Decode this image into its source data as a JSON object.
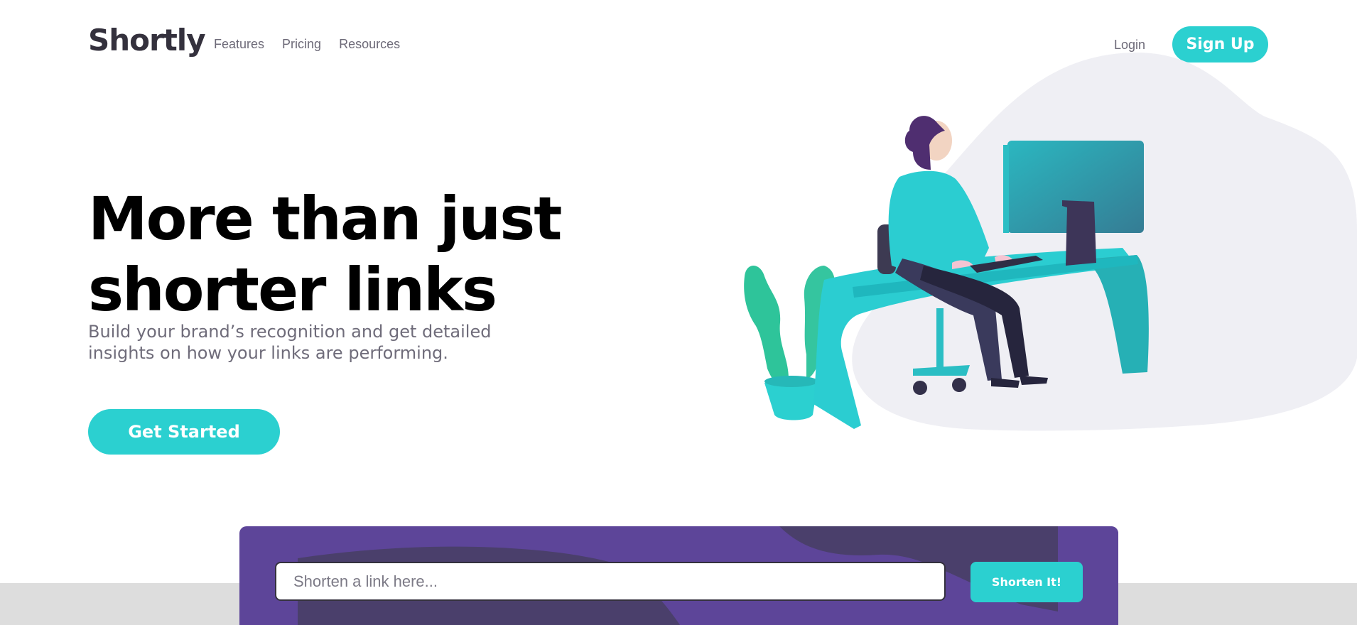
{
  "brand": {
    "name": "Shortly"
  },
  "nav": {
    "items": [
      {
        "label": "Features"
      },
      {
        "label": "Pricing"
      },
      {
        "label": "Resources"
      }
    ]
  },
  "auth": {
    "login_label": "Login",
    "signup_label": "Sign Up"
  },
  "hero": {
    "title_line1": "More than just",
    "title_line2": "shorter links",
    "subtitle": "Build your brand’s recognition and get detailed insights on how your links are performing.",
    "cta_label": "Get Started"
  },
  "shorten": {
    "placeholder": "Shorten a link here...",
    "button_label": "Shorten It!"
  },
  "colors": {
    "accent": "#2bd0d0",
    "panel": "#5d4599",
    "heading": "#34313d",
    "muted": "#6d6a78",
    "band": "#dddddd"
  }
}
